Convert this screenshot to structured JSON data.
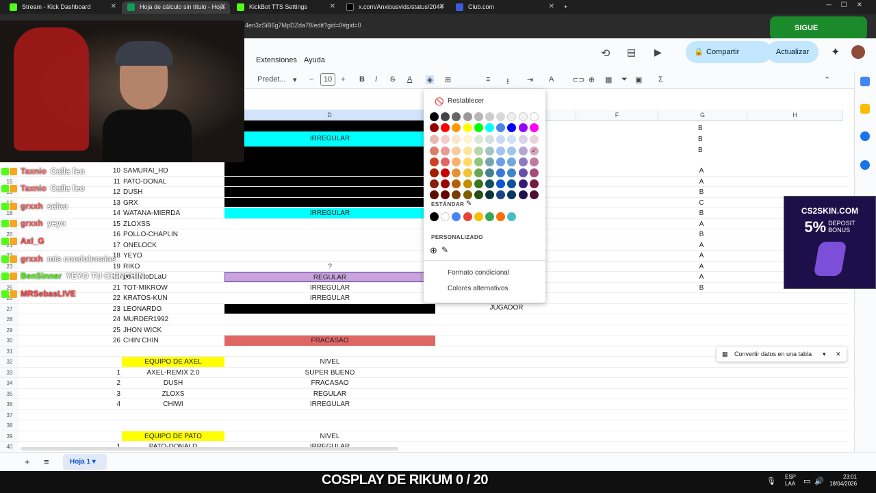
{
  "browser_tabs": [
    {
      "label": "Stream - Kick Dashboard",
      "color": "#53fc18"
    },
    {
      "label": "Hoja de cálculo sin título - Hoja",
      "color": "#0f9d58"
    },
    {
      "label": "KickBot TTS Settings",
      "color": "#53fc18"
    },
    {
      "label": "x.com/Anxiousvids/status/2044",
      "color": "#000000"
    },
    {
      "label": "Club.com",
      "color": "#3b5bdb"
    }
  ],
  "new_tab": "+",
  "url": "4en3zSiB6g7MpDZda78/edit?gid=0#gid=0",
  "menu": {
    "extensions": "Extensiones",
    "help": "Ayuda"
  },
  "toolbar": {
    "font": "Predet...",
    "font_size": "10",
    "share": "Compartir",
    "update": "Actualizar",
    "minus": "−",
    "plus": "+",
    "bold": "B",
    "italic": "I",
    "strike": "S",
    "textcolor": "A",
    "sum": "Σ"
  },
  "columns": [
    "D",
    "F",
    "G",
    "H"
  ],
  "rows": [
    {
      "n": "14",
      "a": "10",
      "b": "SAMURAI_HD",
      "d": "",
      "g": "A"
    },
    {
      "n": "15",
      "a": "11",
      "b": "PATO-DONAL",
      "d": "",
      "g": "A"
    },
    {
      "n": "16",
      "a": "12",
      "b": "DUSH",
      "d": "",
      "g": "B"
    },
    {
      "n": "17",
      "a": "13",
      "b": "GRX",
      "d": "",
      "g": "C"
    },
    {
      "n": "18",
      "a": "14",
      "b": "WATANA-MIERDA",
      "d": "IRREGULAR",
      "g": "B"
    },
    {
      "n": "19",
      "a": "15",
      "b": "ZLOXSS",
      "d": "",
      "g": "A"
    },
    {
      "n": "20",
      "a": "16",
      "b": "POLLO-CHAPLIN",
      "d": "",
      "g": "B"
    },
    {
      "n": "21",
      "a": "17",
      "b": "ONELOCK",
      "d": "",
      "g": "A"
    },
    {
      "n": "22",
      "a": "18",
      "b": "YEYO",
      "d": "",
      "g": "A"
    },
    {
      "n": "23",
      "a": "19",
      "b": "RIKO",
      "d": "?",
      "g": "A"
    },
    {
      "n": "24",
      "a": "20",
      "b": "ponchitoDLaU",
      "d": "REGULAR",
      "g": "A"
    },
    {
      "n": "25",
      "a": "21",
      "b": "TOT-MIKROW",
      "d": "IRREGULAR",
      "g": "B"
    },
    {
      "n": "26",
      "a": "22",
      "b": "KRATOS-KUN",
      "d": "IRREGULAR",
      "g": ""
    },
    {
      "n": "27",
      "a": "23",
      "b": "LEONARDO",
      "d": "",
      "g": ""
    },
    {
      "n": "28",
      "a": "24",
      "b": "MURDER1992",
      "d": "",
      "g": ""
    },
    {
      "n": "29",
      "a": "25",
      "b": "JHON WICK",
      "d": "",
      "g": ""
    },
    {
      "n": "30",
      "a": "26",
      "b": "CHIN CHIN",
      "d": "FRACASAO",
      "g": ""
    },
    {
      "n": "31",
      "a": "",
      "b": "",
      "d": "",
      "g": ""
    },
    {
      "n": "32",
      "a": "",
      "b": "EQUIPO DE AXEL",
      "d": "NIVEL",
      "g": ""
    },
    {
      "n": "33",
      "a": "1",
      "b": "AXEL-REMIX 2.0",
      "d": "SUPER BUENO",
      "g": ""
    },
    {
      "n": "34",
      "a": "2",
      "b": "DUSH",
      "d": "FRACASAO",
      "g": ""
    },
    {
      "n": "35",
      "a": "3",
      "b": "ZLOXS",
      "d": "REGULAR",
      "g": ""
    },
    {
      "n": "36",
      "a": "4",
      "b": "CHIWI",
      "d": "IRREGULAR",
      "g": ""
    },
    {
      "n": "37",
      "a": "",
      "b": "",
      "d": "",
      "g": ""
    },
    {
      "n": "38",
      "a": "",
      "b": "",
      "d": "",
      "g": ""
    },
    {
      "n": "39",
      "a": "",
      "b": "EQUIPO DE PATO",
      "d": "NIVEL",
      "g": ""
    },
    {
      "n": "40",
      "a": "1",
      "b": "PATO-DONALD",
      "d": "IRREGULAR",
      "g": ""
    }
  ],
  "top_cells": {
    "irregular_top": "IRREGULAR",
    "g_top": [
      "B",
      "B",
      "B"
    ],
    "jugador": "JUGADOR"
  },
  "palette": {
    "reset": "Restablecer",
    "standard": "ESTÁNDAR",
    "custom": "PERSONALIZADO",
    "conditional": "Formato condicional",
    "alternating": "Colores alternativos",
    "grid": [
      [
        "#000000",
        "#434343",
        "#666666",
        "#999999",
        "#b7b7b7",
        "#cccccc",
        "#d9d9d9",
        "#efefef",
        "#f3f3f3",
        "#ffffff"
      ],
      [
        "#980000",
        "#ff0000",
        "#ff9900",
        "#ffff00",
        "#00ff00",
        "#00ffff",
        "#4a86e8",
        "#0000ff",
        "#9900ff",
        "#ff00ff"
      ],
      [
        "#e6b8af",
        "#f4cccc",
        "#fce5cd",
        "#fff2cc",
        "#d9ead3",
        "#d0e0e3",
        "#c9daf8",
        "#cfe2f3",
        "#d9d2e9",
        "#ead1dc"
      ],
      [
        "#dd7e6b",
        "#ea9999",
        "#f9cb9c",
        "#ffe599",
        "#b6d7a8",
        "#a2c4c9",
        "#a4c2f4",
        "#9fc5e8",
        "#b4a7d6",
        "#d5a6bd"
      ],
      [
        "#cc4125",
        "#e06666",
        "#f6b26b",
        "#ffd966",
        "#93c47d",
        "#76a5af",
        "#6d9eeb",
        "#6fa8dc",
        "#8e7cc3",
        "#c27ba0"
      ],
      [
        "#a61c00",
        "#cc0000",
        "#e69138",
        "#f1c232",
        "#6aa84f",
        "#45818e",
        "#3c78d8",
        "#3d85c6",
        "#674ea7",
        "#a64d79"
      ],
      [
        "#85200c",
        "#990000",
        "#b45f06",
        "#bf9000",
        "#38761d",
        "#134f5c",
        "#1155cc",
        "#0b5394",
        "#351c75",
        "#741b47"
      ],
      [
        "#5b0f00",
        "#660000",
        "#783f04",
        "#7f6000",
        "#274e13",
        "#0c343d",
        "#1c4587",
        "#073763",
        "#20124d",
        "#4c1130"
      ]
    ],
    "standard_colors": [
      "#000000",
      "#ffffff",
      "#4285f4",
      "#ea4335",
      "#fbbc04",
      "#34a853",
      "#ff6d01",
      "#46bdc6"
    ]
  },
  "chat": [
    {
      "user": "Taxnio",
      "msg": "Calla feo",
      "color": "#ff6b6b"
    },
    {
      "user": "Taxnio",
      "msg": "Calla feo",
      "color": "#ff6b6b"
    },
    {
      "user": "grxxh",
      "msg": "salao",
      "color": "#ff5c5c"
    },
    {
      "user": "grxxh",
      "msg": "yeyo",
      "color": "#ff5c5c"
    },
    {
      "user": "Axl_G",
      "msg": "",
      "color": "#ff4444"
    },
    {
      "user": "grxxh",
      "msg": "mis condolensias",
      "color": "#ff5c5c"
    },
    {
      "user": "BenSinner",
      "msg": "YEYO TU CHINCHIN",
      "color": "#53fc18"
    },
    {
      "user": "MRSebasLIVE",
      "msg": "",
      "color": "#ff4444"
    }
  ],
  "ad": {
    "brand": "CS2SKIN.COM",
    "pct": "5%",
    "line1": "DEPOSIT",
    "line2": "BONUS"
  },
  "follow": "SIGUE",
  "convert": "Convertir datos en una tabla",
  "sheet_tab": "Hoja 1",
  "banner": "COSPLAY DE RIKUM 0 / 20",
  "clock": {
    "time": "23:01",
    "date": "18/04/2026",
    "lang": "ESP",
    "lang2": "LAA"
  }
}
